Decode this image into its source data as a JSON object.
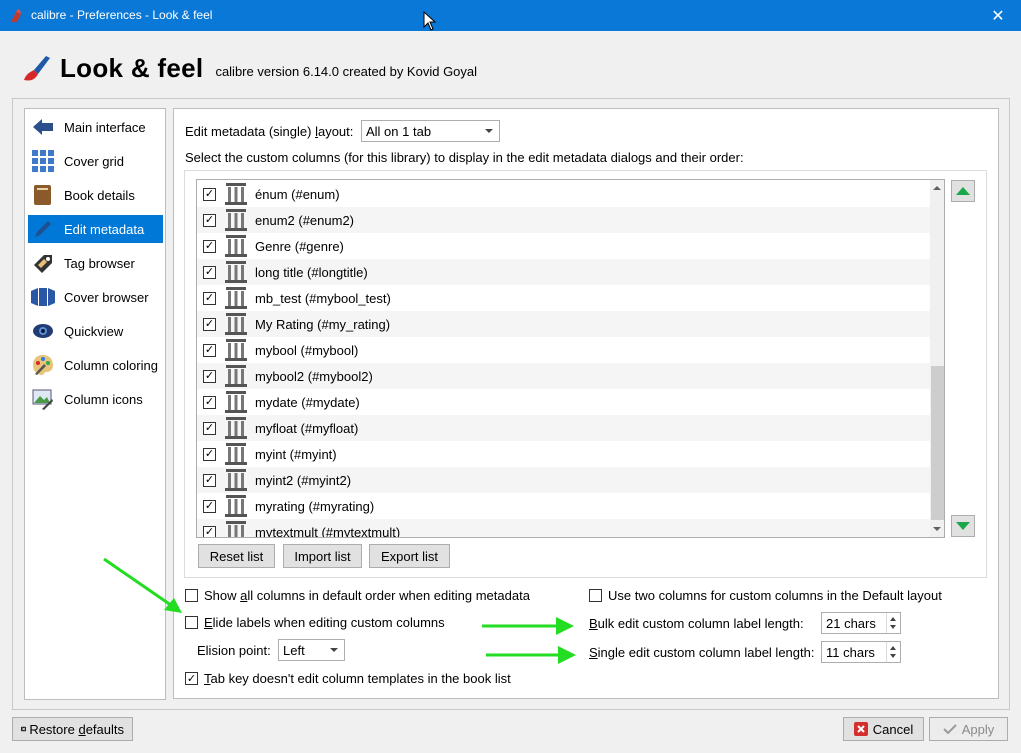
{
  "window": {
    "title": "calibre - Preferences - Look & feel",
    "close_glyph": "✕"
  },
  "header": {
    "title": "Look & feel",
    "version": "calibre version 6.14.0 created by Kovid Goyal"
  },
  "sidebar": {
    "items": [
      {
        "label": "Main interface",
        "icon": "back-arrow-icon"
      },
      {
        "label": "Cover grid",
        "icon": "grid-icon"
      },
      {
        "label": "Book details",
        "icon": "book-icon"
      },
      {
        "label": "Edit metadata",
        "icon": "pen-icon",
        "selected": true
      },
      {
        "label": "Tag browser",
        "icon": "tag-icon"
      },
      {
        "label": "Cover browser",
        "icon": "cover-browser-icon"
      },
      {
        "label": "Quickview",
        "icon": "eye-icon"
      },
      {
        "label": "Column coloring",
        "icon": "palette-icon"
      },
      {
        "label": "Column icons",
        "icon": "image-icon"
      }
    ]
  },
  "main": {
    "layout_label_pre": "Edit metadata (single) ",
    "layout_label_u": "l",
    "layout_label_post": "ayout:",
    "layout_value": "All on 1 tab",
    "columns_description": "Select the custom columns (for this library) to display in the edit metadata dialogs and their order:",
    "columns": [
      {
        "label": "énum (#enum)",
        "checked": true
      },
      {
        "label": "enum2 (#enum2)",
        "checked": true
      },
      {
        "label": "Genre (#genre)",
        "checked": true
      },
      {
        "label": "long title (#longtitle)",
        "checked": true
      },
      {
        "label": "mb_test (#mybool_test)",
        "checked": true
      },
      {
        "label": "My Rating (#my_rating)",
        "checked": true
      },
      {
        "label": "mybool (#mybool)",
        "checked": true
      },
      {
        "label": "mybool2 (#mybool2)",
        "checked": true
      },
      {
        "label": "mydate (#mydate)",
        "checked": true
      },
      {
        "label": "myfloat (#myfloat)",
        "checked": true
      },
      {
        "label": "myint (#myint)",
        "checked": true
      },
      {
        "label": "myint2 (#myint2)",
        "checked": true
      },
      {
        "label": "myrating (#myrating)",
        "checked": true
      },
      {
        "label": "mytextmult (#mytextmult)",
        "checked": true
      }
    ],
    "reset_list": "Reset list",
    "import_list": "Import list",
    "export_list": "Export list",
    "show_all_pre": "Show ",
    "show_all_u": "a",
    "show_all_post": "ll columns in default order when editing metadata",
    "two_columns": "Use two columns for custom columns in the Default layout",
    "elide_u": "E",
    "elide_post": "lide labels when editing custom columns",
    "bulk_u": "B",
    "bulk_post": "ulk edit custom column label length:",
    "bulk_value": "21 chars",
    "elision_label": "Elision point:",
    "elision_value": "Left",
    "single_u": "S",
    "single_post": "ingle edit custom column label length:",
    "single_value": "11 chars",
    "tab_u": "T",
    "tab_post": "ab key doesn't edit column templates in the book list"
  },
  "footer": {
    "restore_u": "d",
    "restore_pre": "Restore ",
    "restore_post": "efaults",
    "cancel": "Cancel",
    "apply": "Apply"
  },
  "colors": {
    "titlebar": "#0a78d7",
    "selection": "#0078d7",
    "annotation_arrows": "#22dd22",
    "move_arrows": "#1aa84a"
  }
}
